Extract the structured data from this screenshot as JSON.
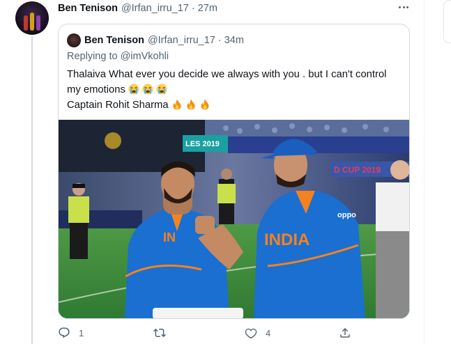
{
  "tweet": {
    "author_name": "Ben Tenison",
    "author_handle": "@Irfan_irru_17",
    "separator": "·",
    "time": "27m",
    "quoted": {
      "author_name": "Ben Tenison",
      "author_handle": "@Irfan_irru_17",
      "separator": "·",
      "time": "34m",
      "replying_label": "Replying to",
      "replying_mention": "@imVkohli",
      "text_line1": "Thalaiva What ever you decide we always with you . but I can't control",
      "text_line2": "my emotions",
      "text_line3": "Captain Rohit Sharma",
      "line2_emoji": [
        "loudly-crying-face",
        "loudly-crying-face",
        "loudly-crying-face"
      ],
      "line3_emoji": [
        "fire",
        "fire",
        "fire"
      ],
      "photo": {
        "jersey_text": "INDIA",
        "banner_text_left": "LES 2019",
        "banner_text_right": "D CUP 2019",
        "sponsor_text": "oppo"
      }
    },
    "actions": {
      "reply_count": "1",
      "retweet_count": "",
      "like_count": "4"
    }
  },
  "colors": {
    "text_primary": "#0f1419",
    "text_secondary": "#536471",
    "border": "#cfd9de",
    "jersey_blue": "#1a6fd1",
    "jersey_orange": "#f58220",
    "pitch_green": "#3f8a3a"
  }
}
